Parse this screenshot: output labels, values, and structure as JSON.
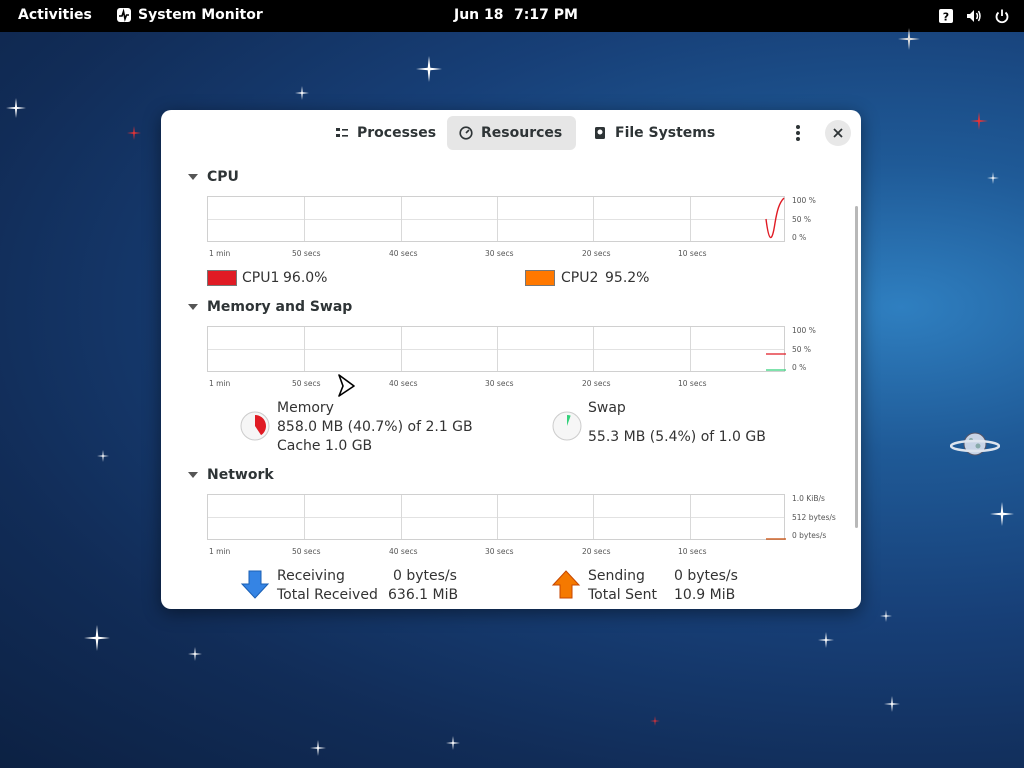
{
  "topbar": {
    "activities": "Activities",
    "app_name": "System Monitor",
    "date": "Jun 18",
    "time": "7:17 PM",
    "tray_icons": [
      "help-icon",
      "volume-icon",
      "power-icon"
    ]
  },
  "window": {
    "tabs": [
      {
        "label": "Processes",
        "icon": "processes-icon",
        "active": false
      },
      {
        "label": "Resources",
        "icon": "resources-icon",
        "active": true
      },
      {
        "label": "File Systems",
        "icon": "filesystems-icon",
        "active": false
      }
    ]
  },
  "cpu": {
    "title": "CPU",
    "x_labels": [
      "1 min",
      "50 secs",
      "40 secs",
      "30 secs",
      "20 secs",
      "10 secs"
    ],
    "y_labels": [
      "100 %",
      "50 %",
      "0 %"
    ],
    "legend": [
      {
        "name": "CPU1",
        "value": "96.0%",
        "color": "#e01b24"
      },
      {
        "name": "CPU2",
        "value": "95.2%",
        "color": "#ff7800"
      }
    ]
  },
  "memory": {
    "title": "Memory and Swap",
    "x_labels": [
      "1 min",
      "50 secs",
      "40 secs",
      "30 secs",
      "20 secs",
      "10 secs"
    ],
    "y_labels": [
      "100 %",
      "50 %",
      "0 %"
    ],
    "memory_label": "Memory",
    "memory_value": "858.0 MB (40.7%) of 2.1 GB",
    "cache_value": "Cache 1.0 GB",
    "memory_fraction": 0.407,
    "memory_color": "#e01b24",
    "swap_label": "Swap",
    "swap_value": "55.3 MB (5.4%) of 1.0 GB",
    "swap_fraction": 0.054,
    "swap_color": "#33d17a"
  },
  "network": {
    "title": "Network",
    "x_labels": [
      "1 min",
      "50 secs",
      "40 secs",
      "30 secs",
      "20 secs",
      "10 secs"
    ],
    "y_labels": [
      "1.0 KiB/s",
      "512 bytes/s",
      "0 bytes/s"
    ],
    "receiving_label": "Receiving",
    "receiving_value": "0 bytes/s",
    "total_received_label": "Total Received",
    "total_received_value": "636.1 MiB",
    "sending_label": "Sending",
    "sending_value": "0 bytes/s",
    "total_sent_label": "Total Sent",
    "total_sent_value": "10.9 MiB",
    "receive_color": "#3584e4",
    "send_color": "#f57900"
  }
}
